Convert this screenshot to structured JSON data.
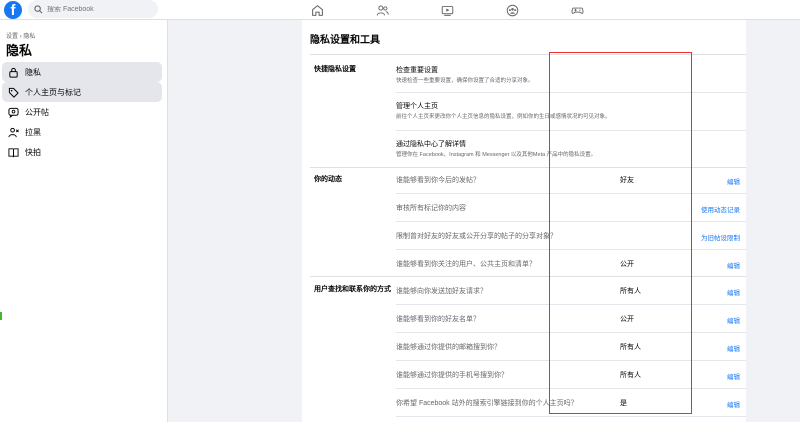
{
  "header": {
    "logo_letter": "f",
    "search_placeholder": "搜索 Facebook",
    "nav_icons": [
      "home-icon",
      "friends-icon",
      "watch-icon",
      "groups-icon",
      "gaming-icon"
    ]
  },
  "sidebar": {
    "breadcrumb": "设置 › 隐私",
    "title": "隐私",
    "items": [
      {
        "label": "隐私",
        "icon": "lock-icon"
      },
      {
        "label": "个人主页与标记",
        "icon": "tag-icon"
      },
      {
        "label": "公开帖",
        "icon": "public-posts-icon"
      },
      {
        "label": "拉黑",
        "icon": "block-user-icon"
      },
      {
        "label": "快拍",
        "icon": "book-icon"
      }
    ]
  },
  "main": {
    "title": "隐私设置和工具",
    "quick": {
      "title": "快捷隐私设置",
      "items": [
        {
          "title": "检查重要设置",
          "desc": "快速检查一些重要设置，确保你设置了合适的分享对象。"
        },
        {
          "title": "管理个人主页",
          "desc": "前往个人主页来更改你个人主页信息的隐私设置，例如你的生日或感情状况的可见对象。"
        },
        {
          "title": "通过隐私中心了解详情",
          "desc": "管理你在 Facebook、Instagram 和 Messenger 以及其他Meta 产品中的隐私设置。"
        }
      ]
    },
    "activity": {
      "title": "你的动态",
      "rows": [
        {
          "label": "谁能够看到你今后的发帖？",
          "value": "好友",
          "action": "编辑"
        },
        {
          "label": "审核所有标记你的内容",
          "value": "",
          "action": "使用动态记录"
        },
        {
          "label": "限制曾对好友的好友或公开分享的帖子的分享对象？",
          "value": "",
          "action": "为旧帖设限制"
        },
        {
          "label": "谁能够看到你关注的用户、公共主页和清单？",
          "value": "公开",
          "action": "编辑"
        }
      ]
    },
    "find": {
      "title": "用户查找和联系你的方式",
      "rows": [
        {
          "label": "谁能够向你发送加好友请求？",
          "value": "所有人",
          "action": "编辑"
        },
        {
          "label": "谁能够看到你的好友名单？",
          "value": "公开",
          "action": "编辑"
        },
        {
          "label": "谁能够通过你提供的邮箱搜到你？",
          "value": "所有人",
          "action": "编辑"
        },
        {
          "label": "谁能够通过你提供的手机号搜到你？",
          "value": "所有人",
          "action": "编辑"
        },
        {
          "label": "你希望 Facebook 站外的搜索引擎链接到你的个人主页吗？",
          "value": "是",
          "action": "编辑"
        }
      ]
    }
  },
  "colors": {
    "brand": "#1877f2",
    "link": "#1877f2",
    "highlight_box": "#e63030"
  }
}
